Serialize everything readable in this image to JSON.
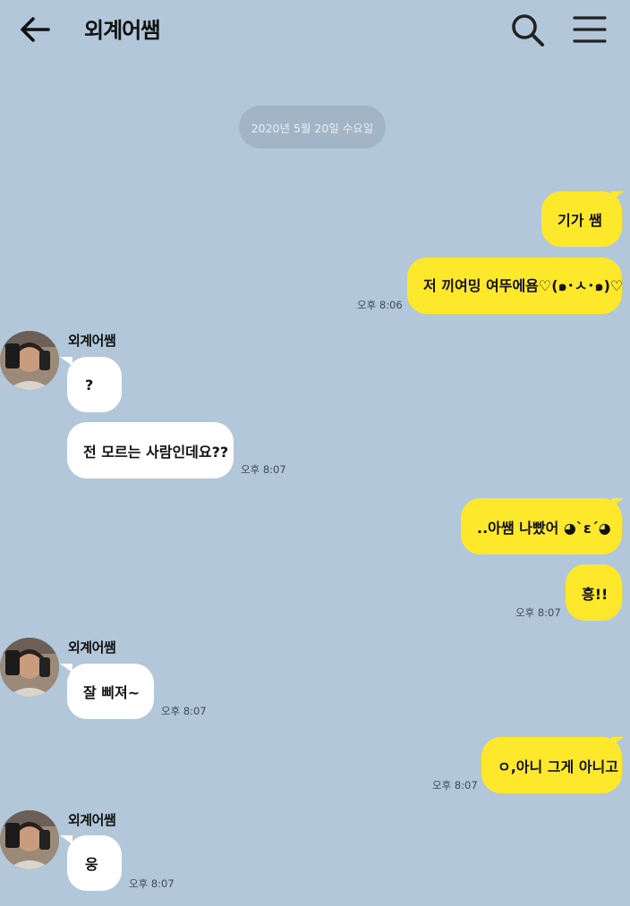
{
  "header": {
    "title": "외계어쌤",
    "back_icon": "arrow-left-icon",
    "search_icon": "search-icon",
    "menu_icon": "hamburger-menu-icon"
  },
  "date_divider": "2020년 5월 20일 수요일",
  "contact": {
    "name": "외계어쌤"
  },
  "messages": [
    {
      "from": "me",
      "text": "기가 쌤"
    },
    {
      "from": "me",
      "text": "저 끼여밍 여뚜에욤♡(๑･ㅅ･๑)♡",
      "time": "오후 8:06"
    },
    {
      "from": "them",
      "text": "?"
    },
    {
      "from": "them",
      "text": "전 모르는 사람인데요??",
      "time": "오후 8:07"
    },
    {
      "from": "me",
      "text": "..아쌤 나빴어 ◕ˋεˊ◕"
    },
    {
      "from": "me",
      "text": "흥!!",
      "time": "오후 8:07"
    },
    {
      "from": "them",
      "text": "잘 삐져~",
      "time": "오후 8:07"
    },
    {
      "from": "me",
      "text": "ㅇ,아니 그게 아니고",
      "time": "오후 8:07"
    },
    {
      "from": "them",
      "text": "웅",
      "time": "오후 8:07"
    }
  ],
  "colors": {
    "background": "#b2c7da",
    "my_bubble": "#fee82b",
    "their_bubble": "#ffffff",
    "date_pill": "#a1b5c7"
  }
}
